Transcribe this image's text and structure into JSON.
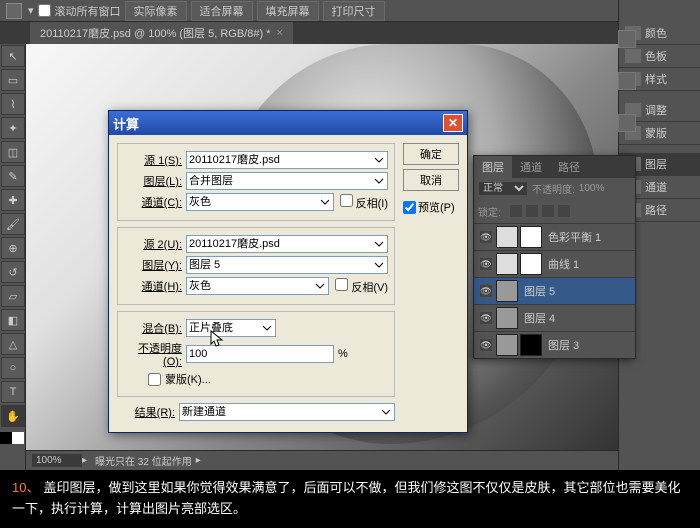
{
  "topbar": {
    "scroll": "滚动所有窗口",
    "b1": "实际像素",
    "b2": "适合屏幕",
    "b3": "填充屏幕",
    "b4": "打印尺寸"
  },
  "doctab": {
    "title": "20110217磨皮.psd @ 100% (图层 5, RGB/8#) *"
  },
  "status": {
    "zoom": "100%",
    "doc": "曝光只在 32 位起作用"
  },
  "rpanel": {
    "p1": "颜色",
    "p2": "色板",
    "p3": "样式",
    "p4": "调整",
    "p5": "蒙版",
    "p6": "图层",
    "p7": "通道",
    "p8": "路径"
  },
  "layerspanel": {
    "t1": "图层",
    "t2": "通道",
    "t3": "路径",
    "mode": "正常",
    "oplabel": "不透明度:",
    "opval": "100%",
    "lock": "锁定:"
  },
  "layers": [
    {
      "name": "色彩平衡 1"
    },
    {
      "name": "曲线 1"
    },
    {
      "name": "图层 5"
    },
    {
      "name": "图层 4"
    },
    {
      "name": "图层 3"
    }
  ],
  "dlg": {
    "title": "计算",
    "ok": "确定",
    "cancel": "取消",
    "preview": "预览(P)",
    "s1": "源 1(S):",
    "s1v": "20110217磨皮.psd",
    "l1": "图层(L):",
    "l1v": "合并图层",
    "c1": "通道(C):",
    "c1v": "灰色",
    "inv1": "反相(I)",
    "s2": "源 2(U):",
    "s2v": "20110217磨皮.psd",
    "l2": "图层(Y):",
    "l2v": "图层  5",
    "c2": "通道(H):",
    "c2v": "灰色",
    "inv2": "反相(V)",
    "blend": "混合(B):",
    "blendv": "正片叠底",
    "op": "不透明度(O):",
    "opv": "100",
    "pct": "%",
    "mask": "蒙版(K)...",
    "res": "结果(R):",
    "resv": "新建通道"
  },
  "caption": {
    "n": "10、",
    "text": "盖印图层，做到这里如果你觉得效果满意了，后面可以不做，但我们修这图不仅仅是皮肤，其它部位也需要美化一下，执行计算，计算出图片亮部选区。"
  }
}
